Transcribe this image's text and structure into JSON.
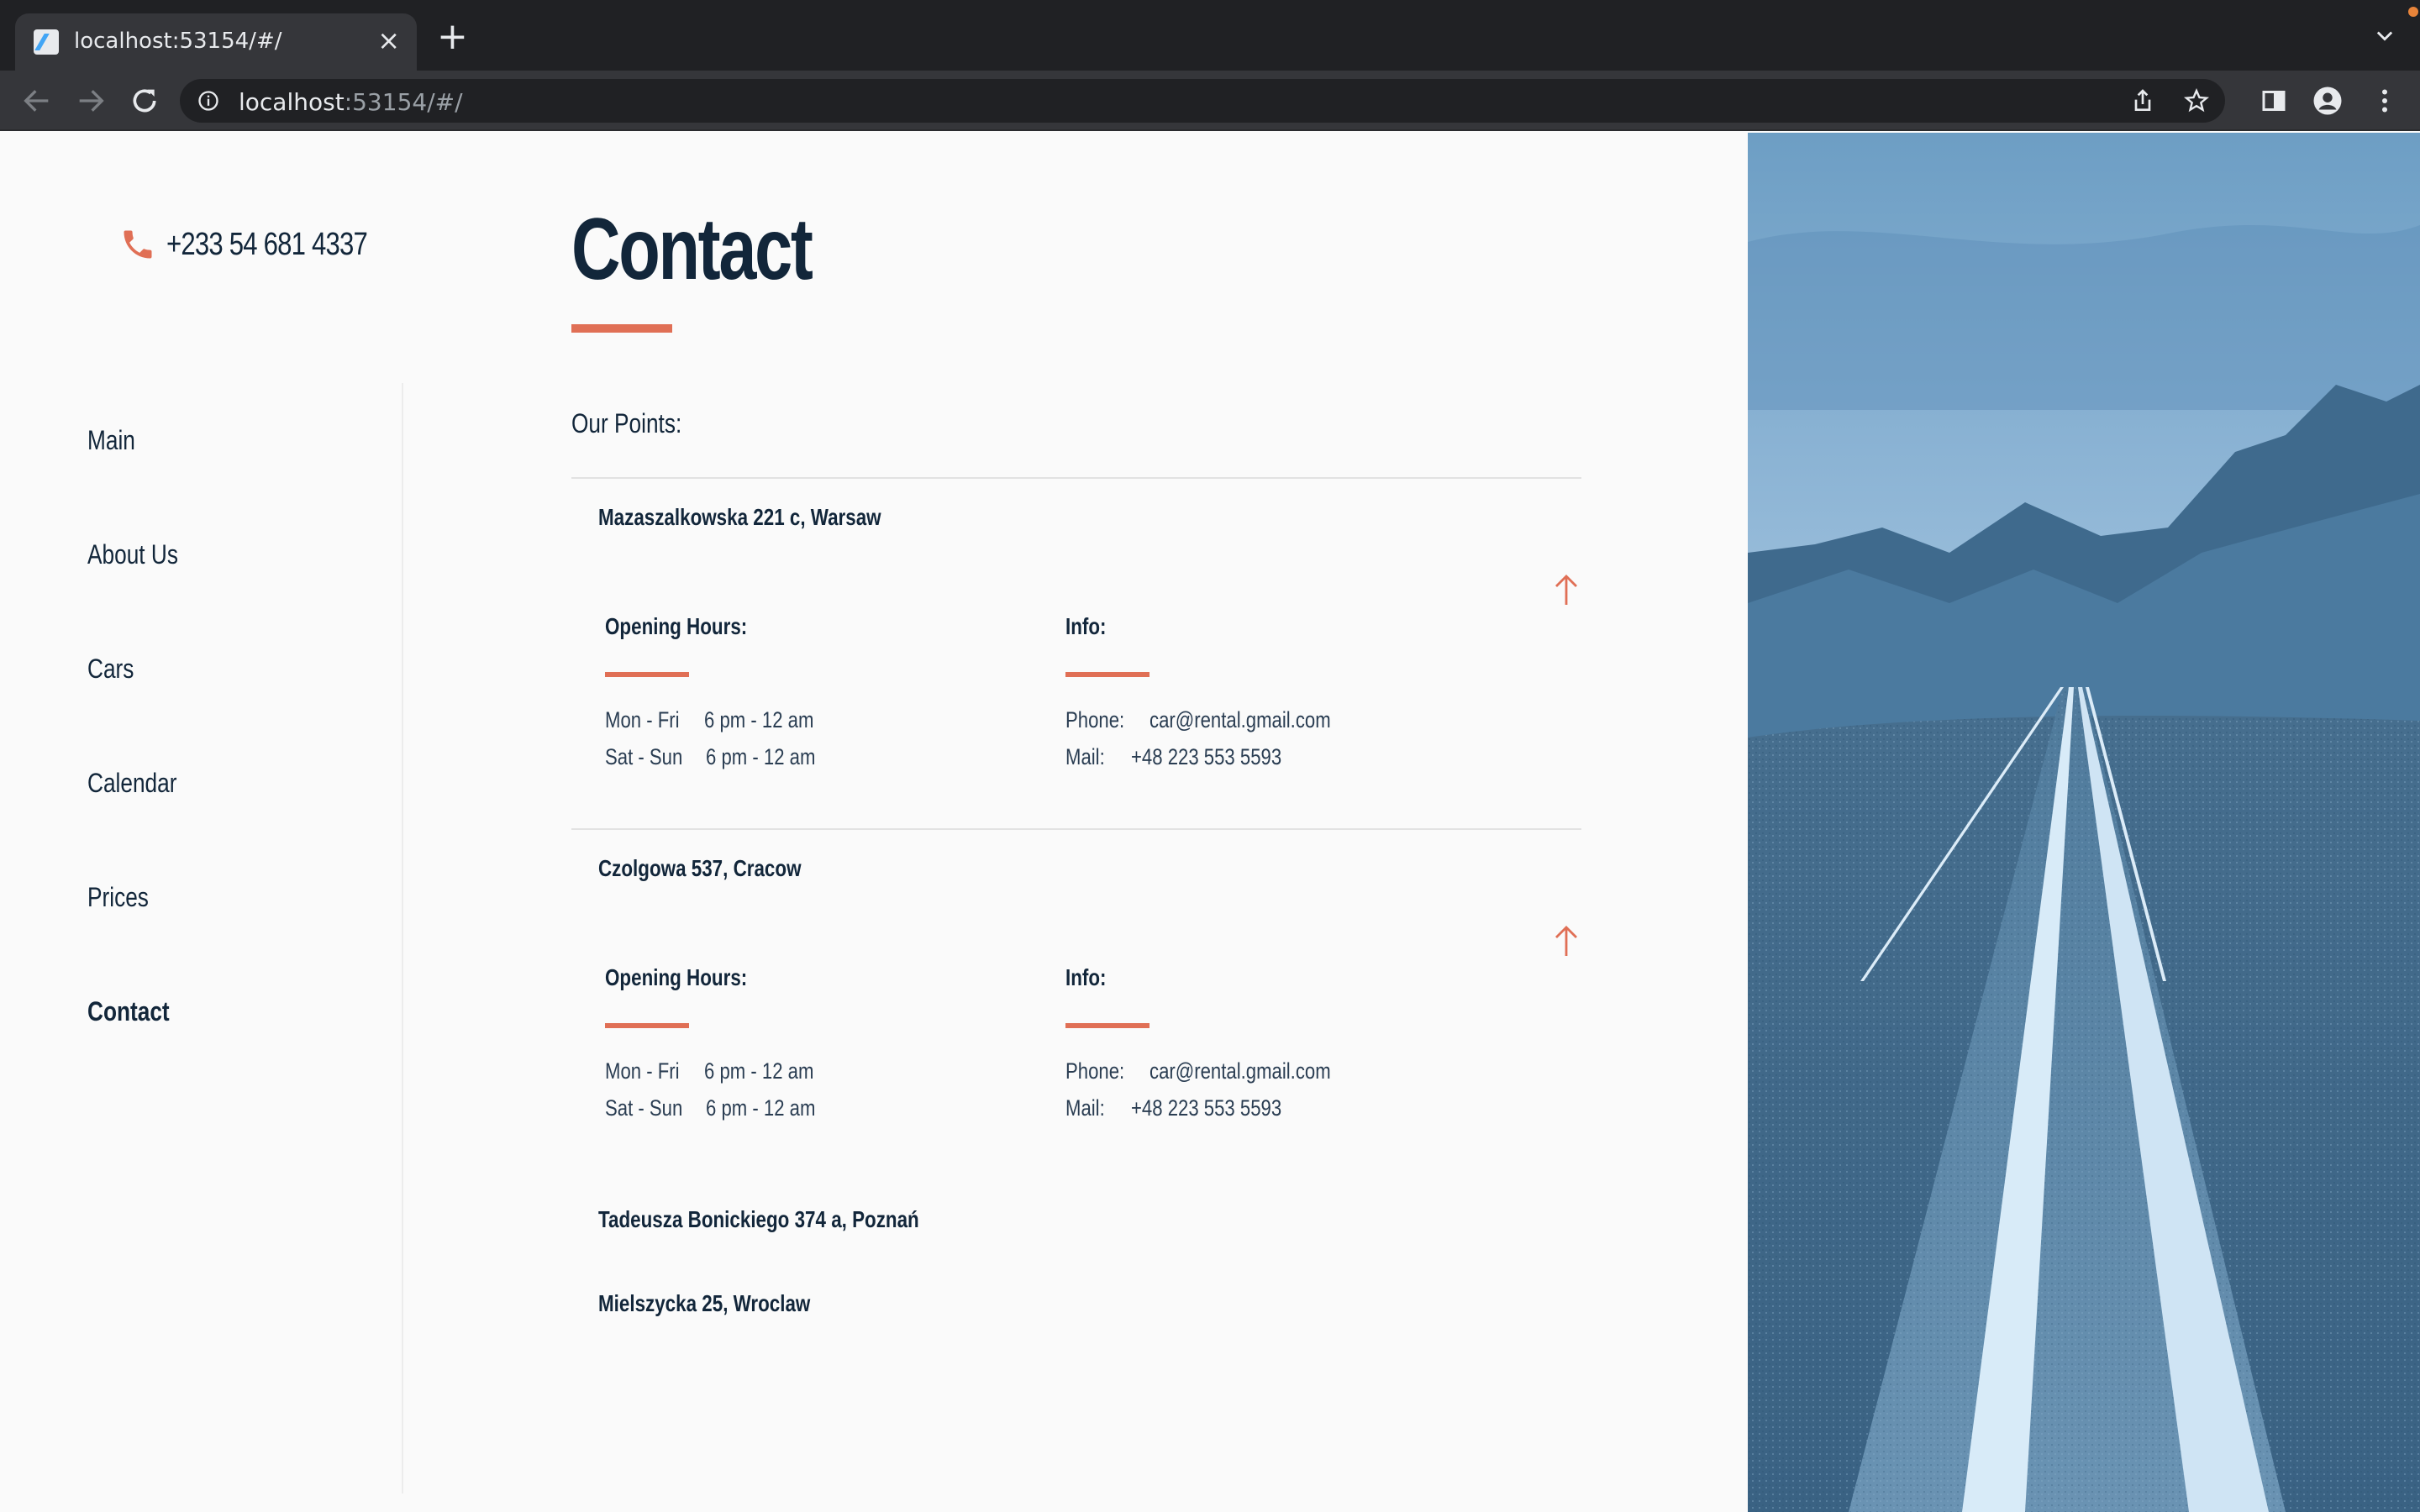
{
  "browser": {
    "tab_title": "localhost:53154/#/",
    "url_host": "localhost",
    "url_rest": ":53154/#/"
  },
  "header": {
    "phone": "+233 54 681 4337"
  },
  "sidebar": {
    "items": [
      {
        "label": "Main"
      },
      {
        "label": "About Us"
      },
      {
        "label": "Cars"
      },
      {
        "label": "Calendar"
      },
      {
        "label": "Prices"
      },
      {
        "label": "Contact"
      }
    ],
    "active": "Contact"
  },
  "main": {
    "title": "Contact",
    "points_label": "Our Points:",
    "points": [
      {
        "address": "Mazaszalkowska 221 c, Warsaw",
        "expanded": true,
        "hours_title": "Opening Hours:",
        "info_title": "Info:",
        "hours": [
          {
            "days": "Mon - Fri",
            "time": "6 pm - 12 am"
          },
          {
            "days": "Sat - Sun",
            "time": "6 pm - 12 am"
          }
        ],
        "info": [
          {
            "label": "Phone:",
            "value": "car@rental.gmail.com"
          },
          {
            "label": "Mail:",
            "value": "+48 223 553 5593"
          }
        ]
      },
      {
        "address": "Czolgowa 537, Cracow",
        "expanded": true,
        "hours_title": "Opening Hours:",
        "info_title": "Info:",
        "hours": [
          {
            "days": "Mon - Fri",
            "time": "6 pm - 12 am"
          },
          {
            "days": "Sat - Sun",
            "time": "6 pm - 12 am"
          }
        ],
        "info": [
          {
            "label": "Phone:",
            "value": "car@rental.gmail.com"
          },
          {
            "label": "Mail:",
            "value": "+48 223 553 5593"
          }
        ]
      },
      {
        "address": "Tadeusza Bonickiego 374 a, Poznań",
        "expanded": false
      },
      {
        "address": "Mielszycka 25, Wroclaw",
        "expanded": false
      }
    ]
  },
  "colors": {
    "accent": "#e06f55",
    "text": "#12263a",
    "background": "#fafafa"
  }
}
